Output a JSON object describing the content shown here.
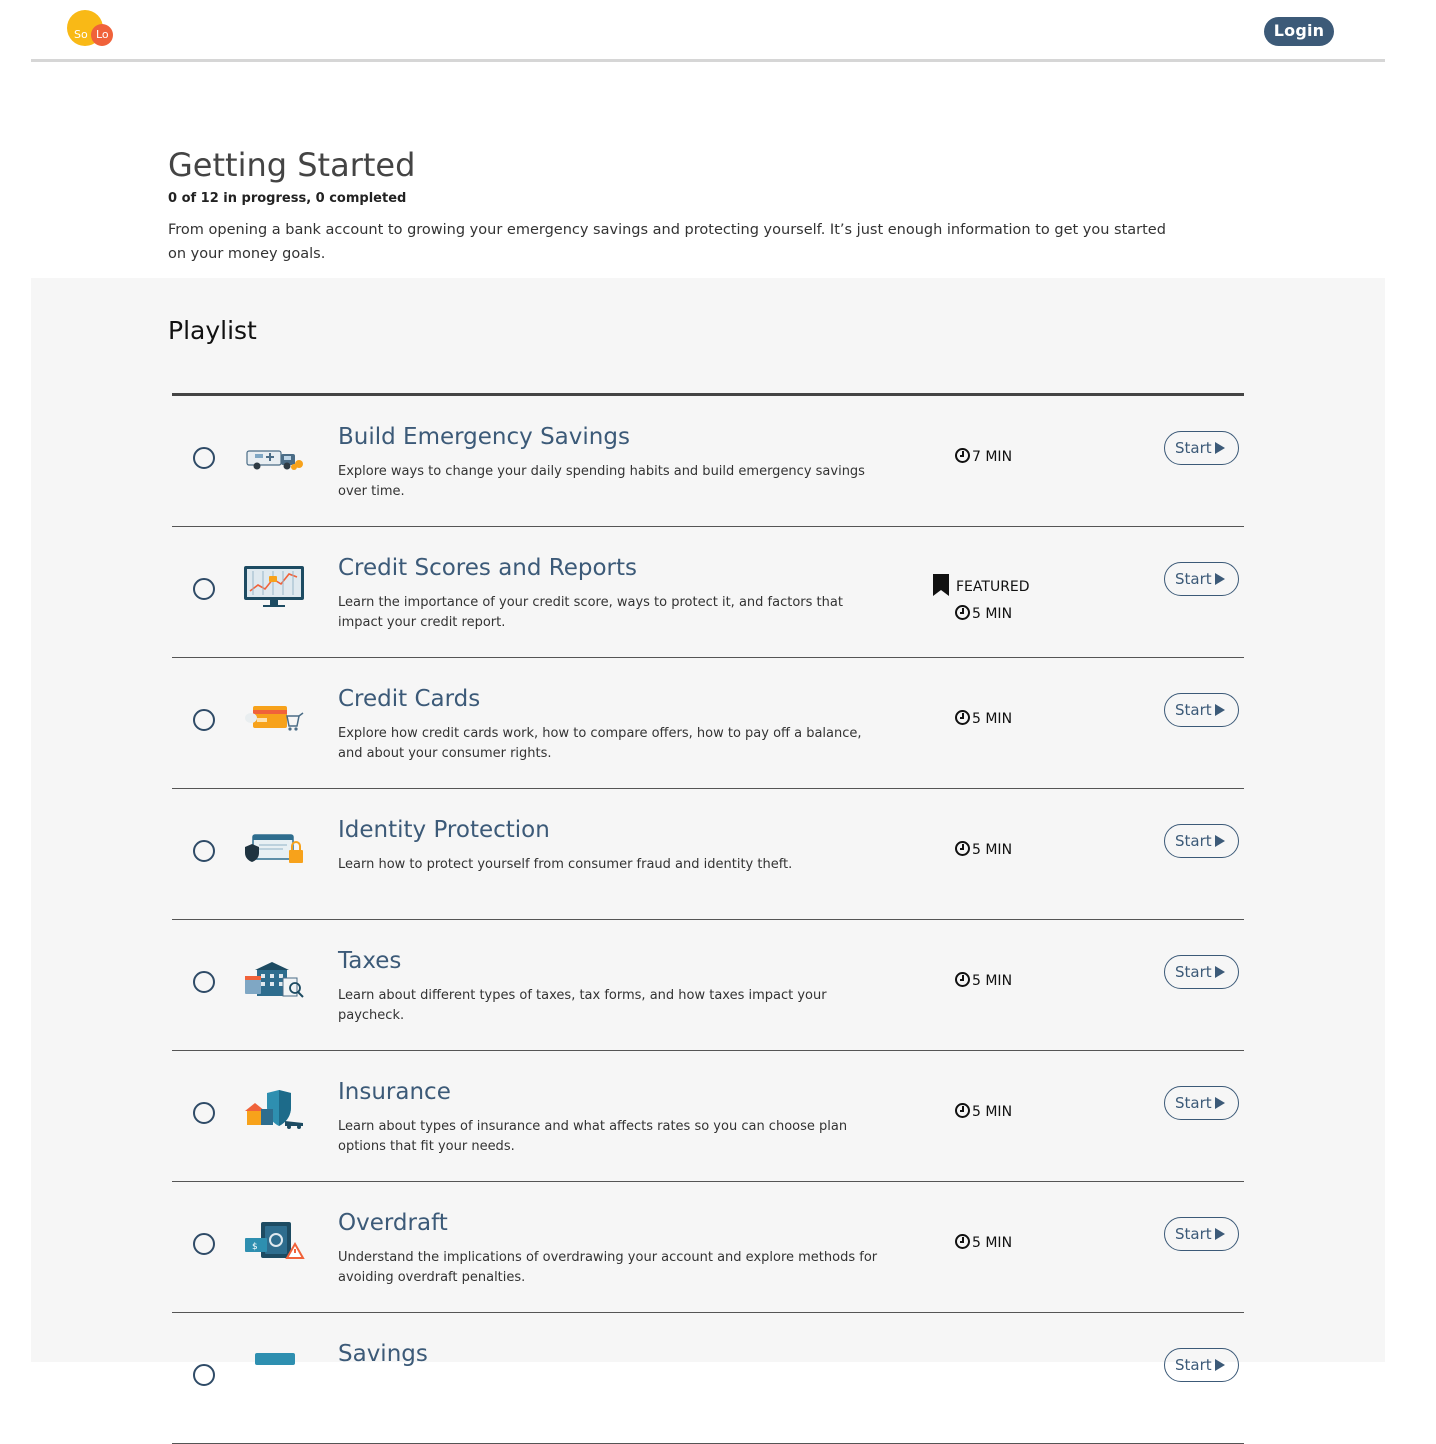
{
  "header": {
    "logo": {
      "left": "So",
      "right": "Lo"
    },
    "login_label": "Login"
  },
  "intro": {
    "title": "Getting Started",
    "progress": "0 of 12 in progress, 0 completed",
    "description": "From opening a bank account to growing your emergency savings and protecting yourself. It’s just enough information to get you started on your money goals."
  },
  "playlist": {
    "title": "Playlist",
    "featured_label": "FEATURED",
    "start_label": "Start",
    "items": [
      {
        "title": "Build Emergency Savings",
        "description": "Explore ways to change your daily spending habits and build emergency savings over time.",
        "duration": "7 MIN",
        "featured": false,
        "icon": "ambulance-icon"
      },
      {
        "title": "Credit Scores and Reports",
        "description": "Learn the importance of your credit score, ways to protect it, and factors that impact your credit report.",
        "duration": "5 MIN",
        "featured": true,
        "icon": "monitor-chart-icon"
      },
      {
        "title": "Credit Cards",
        "description": "Explore how credit cards work, how to compare offers, how to pay off a balance, and about your consumer rights.",
        "duration": "5 MIN",
        "featured": false,
        "icon": "credit-card-icon"
      },
      {
        "title": "Identity Protection",
        "description": "Learn how to protect yourself from consumer fraud and identity theft.",
        "duration": "5 MIN",
        "featured": false,
        "icon": "id-card-shield-icon"
      },
      {
        "title": "Taxes",
        "description": "Learn about different types of taxes, tax forms, and how taxes impact your paycheck.",
        "duration": "5 MIN",
        "featured": false,
        "icon": "tax-building-icon"
      },
      {
        "title": "Insurance",
        "description": "Learn about types of insurance and what affects rates so you can choose plan options that fit your needs.",
        "duration": "5 MIN",
        "featured": false,
        "icon": "insurance-shield-icon"
      },
      {
        "title": "Overdraft",
        "description": "Understand the implications of overdrawing your account and explore methods for avoiding overdraft penalties.",
        "duration": "5 MIN",
        "featured": false,
        "icon": "overdraft-safe-icon"
      },
      {
        "title": "Savings",
        "description": "",
        "duration": "",
        "featured": false,
        "icon": "savings-icon"
      }
    ]
  },
  "colors": {
    "accent": "#3c5a78",
    "logo_yellow": "#f9b916",
    "logo_orange": "#f0623a",
    "section_bg": "#f6f6f6"
  }
}
